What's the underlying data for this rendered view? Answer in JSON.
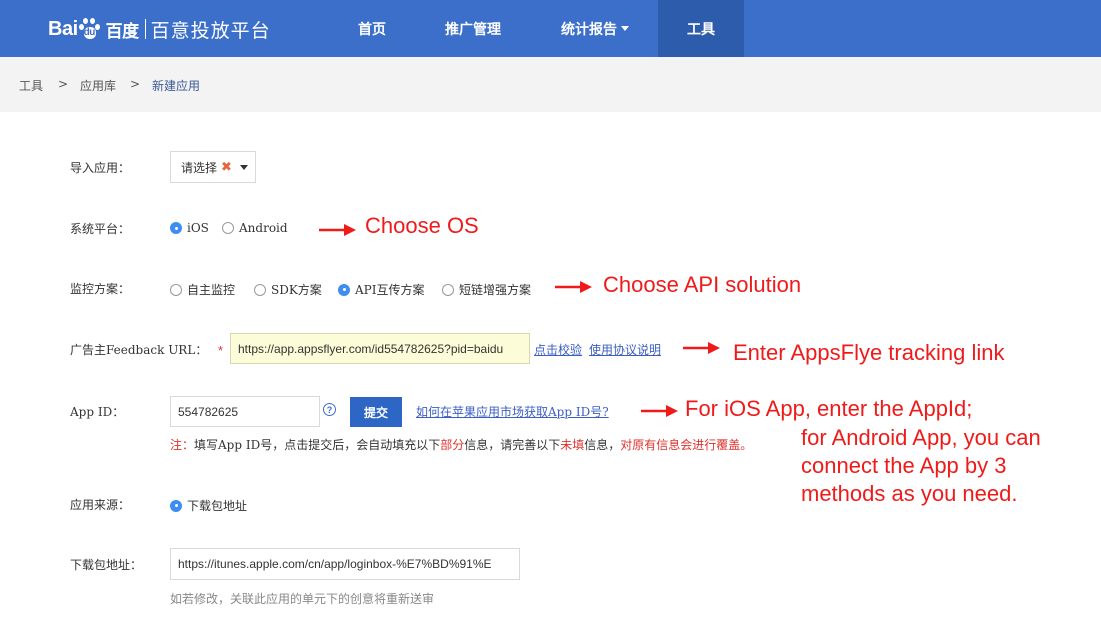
{
  "header": {
    "logo_text_left": "Bai",
    "logo_text_du": "du",
    "logo_text_cn": "百度",
    "product_name": "百意投放平台",
    "nav": [
      {
        "label": "首页"
      },
      {
        "label": "推广管理"
      },
      {
        "label": "统计报告"
      },
      {
        "label": "工具"
      }
    ]
  },
  "breadcrumb": {
    "items": [
      "工具",
      "应用库",
      "新建应用"
    ],
    "separator": ">"
  },
  "form": {
    "import_app": {
      "label": "导入应用：",
      "value": "请选择",
      "clear": "✖"
    },
    "platform": {
      "label": "系统平台：",
      "options": [
        "iOS",
        "Android"
      ],
      "selected": "iOS"
    },
    "monitor": {
      "label": "监控方案：",
      "options": [
        "自主监控",
        "SDK方案",
        "API互传方案",
        "短链增强方案"
      ],
      "selected": "API互传方案"
    },
    "feedback_url": {
      "label": "广告主Feedback URL：",
      "required": "*",
      "value": "https://app.appsflyer.com/id554782625?pid=baidu",
      "link_verify": "点击校验",
      "link_protocol": "使用协议说明"
    },
    "app_id": {
      "label": "App ID：",
      "value": "554782625",
      "help": "?",
      "submit_label": "提交",
      "link_how": "如何在苹果应用市场获取App ID号?"
    },
    "note": {
      "prefix": "注：",
      "part1": "填写App ID号，点击提交后，会自动填充以下",
      "red1": "部分",
      "part2": "信息，请完善以下",
      "red2": "未填",
      "part3": "信息，",
      "red3": "对原有信息会进行覆盖。"
    },
    "app_source": {
      "label": "应用来源：",
      "option": "下载包地址"
    },
    "download_url": {
      "label": "下载包地址：",
      "value": "https://itunes.apple.com/cn/app/loginbox-%E7%BD%91%E",
      "hint": "如若修改，关联此应用的单元下的创意将重新送审"
    }
  },
  "annotations": {
    "choose_os": "Choose OS",
    "choose_api": "Choose API solution",
    "enter_link": "Enter AppsFlye tracking link",
    "ios_line": "For iOS App, enter the AppId;",
    "android_lines": [
      "for Android App, you can",
      "connect the App by 3",
      "methods as you need."
    ]
  },
  "colors": {
    "header_bg": "#3b6fc9",
    "nav_active_bg": "#2d5cad",
    "annotation_red": "#f01a1a",
    "radio_on": "#3d8ef0",
    "link_blue": "#3b5ec2"
  }
}
